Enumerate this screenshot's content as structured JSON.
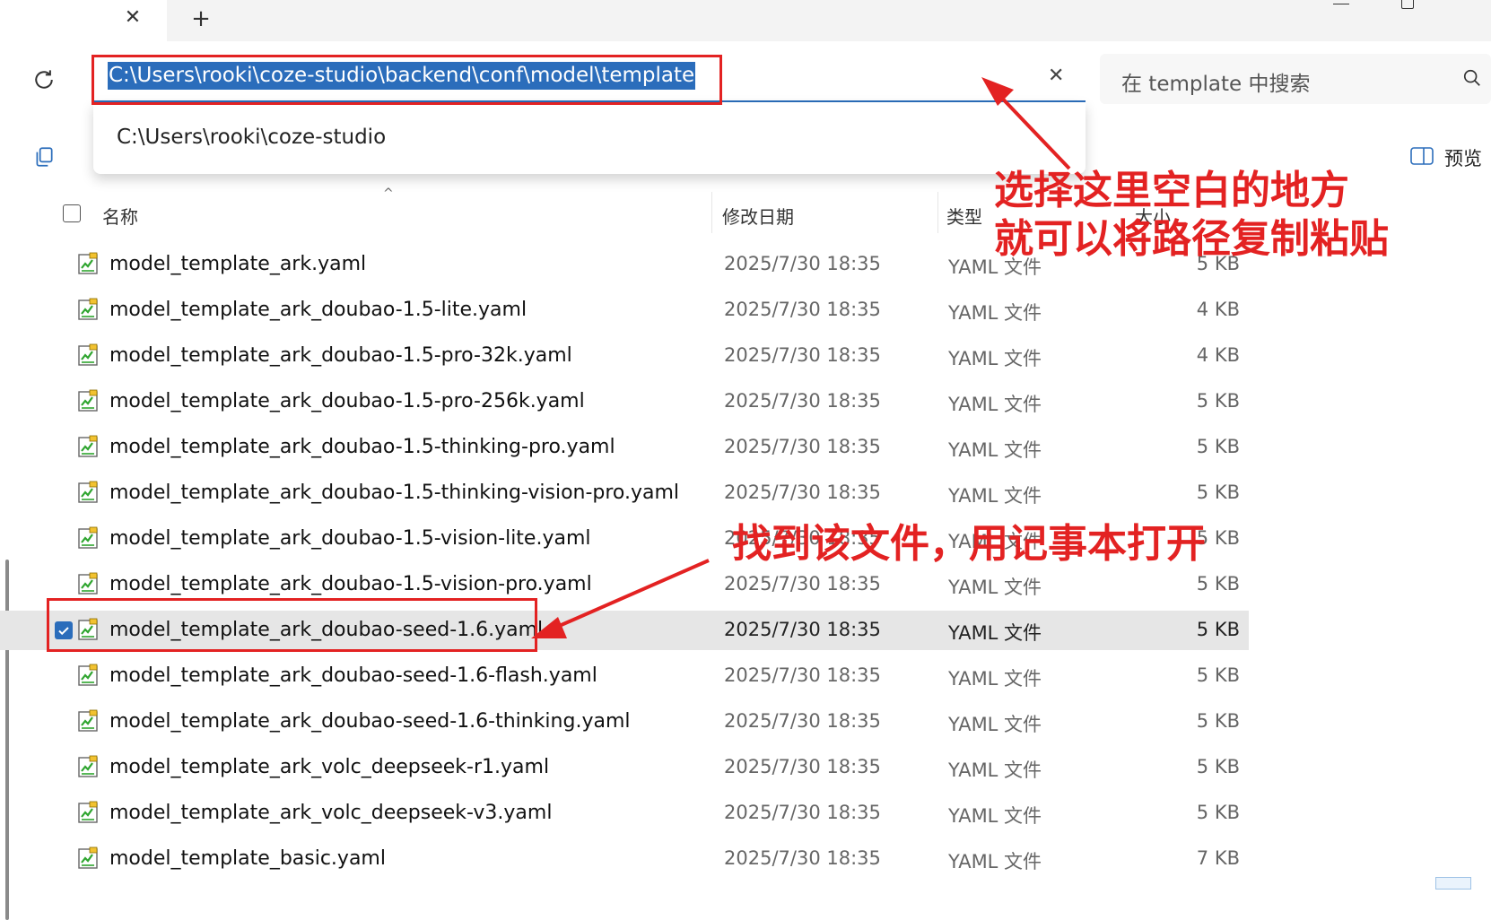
{
  "titlebar": {
    "close_tab_glyph": "✕",
    "new_tab_glyph": "+"
  },
  "address": {
    "path": "C:\\Users\\rooki\\coze-studio\\backend\\conf\\model\\template",
    "suggestion": "C:\\Users\\rooki\\coze-studio",
    "clear_glyph": "✕"
  },
  "search": {
    "placeholder": "在 template 中搜索"
  },
  "toolbar": {
    "preview_label": "预览"
  },
  "columns": {
    "name": "名称",
    "date": "修改日期",
    "type": "类型",
    "size": "大小"
  },
  "files": [
    {
      "name": "model_template_ark.yaml",
      "date": "2025/7/30 18:35",
      "type": "YAML 文件",
      "size": "5 KB"
    },
    {
      "name": "model_template_ark_doubao-1.5-lite.yaml",
      "date": "2025/7/30 18:35",
      "type": "YAML 文件",
      "size": "4 KB"
    },
    {
      "name": "model_template_ark_doubao-1.5-pro-32k.yaml",
      "date": "2025/7/30 18:35",
      "type": "YAML 文件",
      "size": "4 KB"
    },
    {
      "name": "model_template_ark_doubao-1.5-pro-256k.yaml",
      "date": "2025/7/30 18:35",
      "type": "YAML 文件",
      "size": "5 KB"
    },
    {
      "name": "model_template_ark_doubao-1.5-thinking-pro.yaml",
      "date": "2025/7/30 18:35",
      "type": "YAML 文件",
      "size": "5 KB"
    },
    {
      "name": "model_template_ark_doubao-1.5-thinking-vision-pro.yaml",
      "date": "2025/7/30 18:35",
      "type": "YAML 文件",
      "size": "5 KB"
    },
    {
      "name": "model_template_ark_doubao-1.5-vision-lite.yaml",
      "date": "2025/7/30 18:35",
      "type": "YAML 文件",
      "size": "5 KB"
    },
    {
      "name": "model_template_ark_doubao-1.5-vision-pro.yaml",
      "date": "2025/7/30 18:35",
      "type": "YAML 文件",
      "size": "5 KB"
    },
    {
      "name": "model_template_ark_doubao-seed-1.6.yaml",
      "date": "2025/7/30 18:35",
      "type": "YAML 文件",
      "size": "5 KB",
      "selected": true
    },
    {
      "name": "model_template_ark_doubao-seed-1.6-flash.yaml",
      "date": "2025/7/30 18:35",
      "type": "YAML 文件",
      "size": "5 KB"
    },
    {
      "name": "model_template_ark_doubao-seed-1.6-thinking.yaml",
      "date": "2025/7/30 18:35",
      "type": "YAML 文件",
      "size": "5 KB"
    },
    {
      "name": "model_template_ark_volc_deepseek-r1.yaml",
      "date": "2025/7/30 18:35",
      "type": "YAML 文件",
      "size": "5 KB"
    },
    {
      "name": "model_template_ark_volc_deepseek-v3.yaml",
      "date": "2025/7/30 18:35",
      "type": "YAML 文件",
      "size": "5 KB"
    },
    {
      "name": "model_template_basic.yaml",
      "date": "2025/7/30 18:35",
      "type": "YAML 文件",
      "size": "7 KB"
    }
  ],
  "annotations": {
    "callout_top_line1": "选择这里空白的地方",
    "callout_top_line2": "就可以将路径复制粘贴",
    "callout_mid": "找到该文件，用记事本打开",
    "color": "#e32222"
  },
  "colors": {
    "accent": "#2b6dbb",
    "selected_row": "#e6e6e6"
  }
}
